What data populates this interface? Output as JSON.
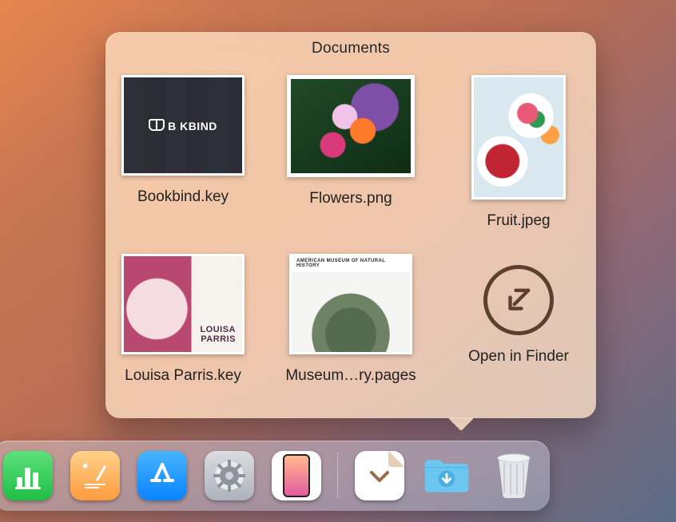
{
  "popover": {
    "title": "Documents",
    "items": [
      {
        "label": "Bookbind.key"
      },
      {
        "label": "Flowers.png"
      },
      {
        "label": "Fruit.jpeg"
      },
      {
        "label": "Louisa Parris.key"
      },
      {
        "label": "Museum…ry.pages"
      }
    ],
    "open_in_finder_label": "Open in Finder"
  },
  "dock": {
    "apps": [
      {
        "name": "numbers-app"
      },
      {
        "name": "pages-app"
      },
      {
        "name": "app-store-app"
      },
      {
        "name": "system-settings-app"
      },
      {
        "name": "iphone-mirroring-app"
      }
    ],
    "stacks": [
      {
        "name": "recents-stack"
      },
      {
        "name": "downloads-folder"
      }
    ],
    "trash_name": "trash"
  }
}
